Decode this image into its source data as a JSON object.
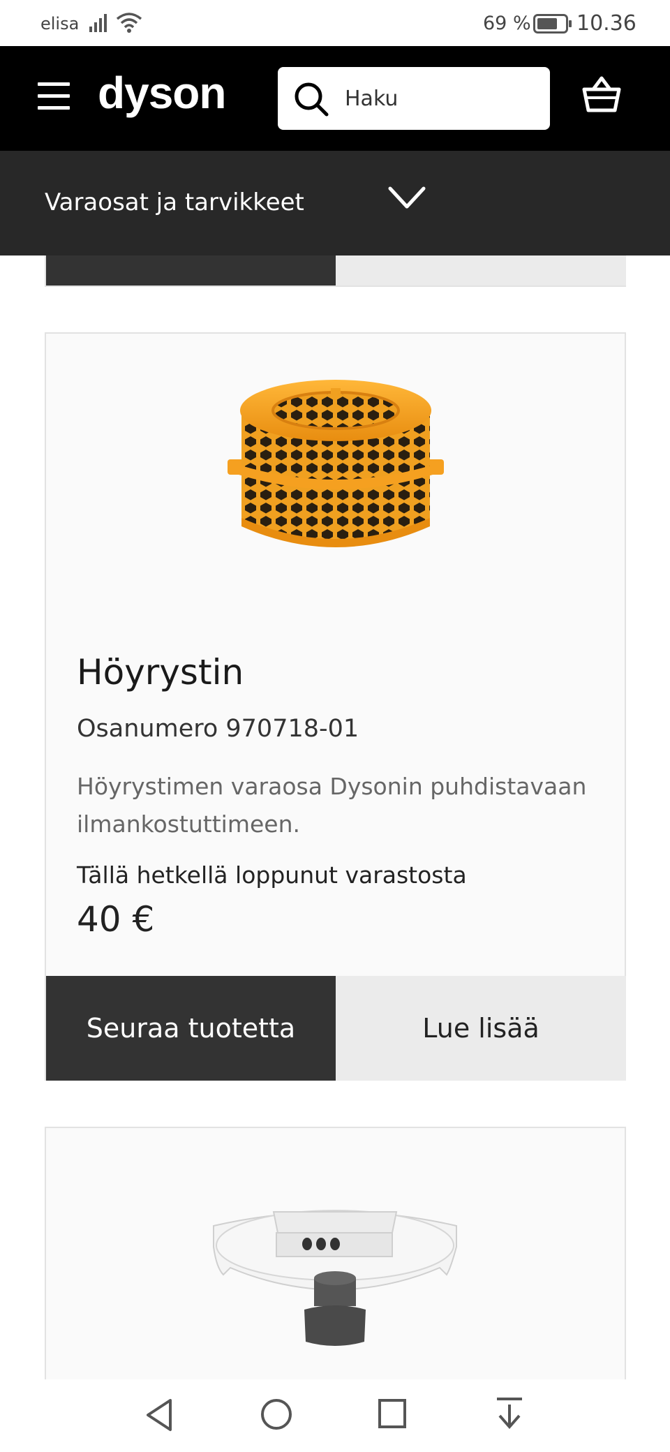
{
  "status_bar": {
    "carrier": "elisa",
    "battery_percent": "69 %",
    "time": "10.36",
    "icons": [
      "signal-icon",
      "wifi-icon",
      "battery-icon"
    ]
  },
  "header": {
    "logo": "dyson",
    "search_placeholder": "Haku",
    "icons": [
      "menu-icon",
      "search-icon",
      "basket-icon"
    ]
  },
  "category_bar": {
    "label": "Varaosat ja tarvikkeet",
    "icon": "chevron-down-icon"
  },
  "product": {
    "title": "Höyrystin",
    "part_number": "Osanumero 970718-01",
    "description": "Höyrystimen varaosa Dysonin puhdistavaan ilmankostuttimeen.",
    "stock_status": "Tällä hetkellä loppunut varastosta",
    "price": "40 €",
    "follow_button": "Seuraa tuotetta",
    "more_button": "Lue lisää"
  },
  "navigation_bar": {
    "icons": [
      "back-icon",
      "home-icon",
      "recent-apps-icon",
      "notification-down-icon"
    ]
  },
  "colors": {
    "header_bg": "#000000",
    "category_bg": "#282828",
    "primary_button": "#333333",
    "secondary_button": "#ebebeb",
    "evaporator_orange": "#f5a623"
  }
}
